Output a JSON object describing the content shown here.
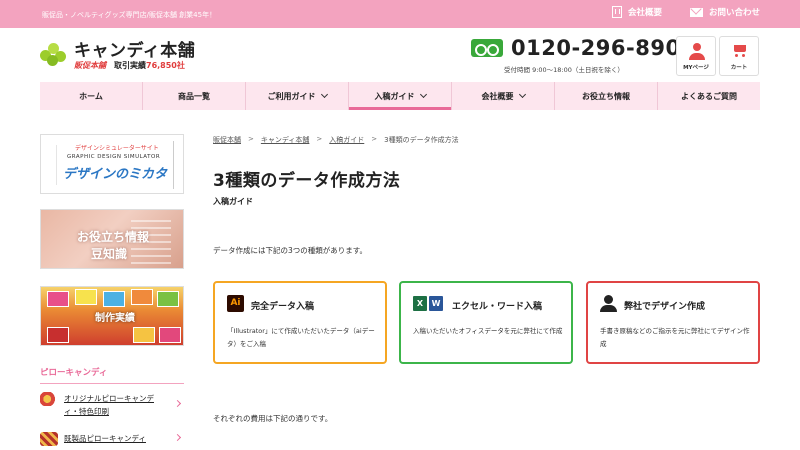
{
  "topbar": {
    "tagline": "販促品・ノベルティグッズ専門店/販促本舗 創業45年！",
    "company_label": "会社概要",
    "contact_label": "お問い合わせ"
  },
  "header": {
    "logo_name": "キャンディ本舗",
    "logo_brand": "販促本舗",
    "logo_trades": "取引実績",
    "logo_count": "76,850社",
    "tel": "0120-296-890",
    "hours": "受付時間 9:00～18:00（土日祝を除く）",
    "mypage_label": "MYページ",
    "cart_label": "カート"
  },
  "nav": {
    "items": [
      {
        "label": "ホーム"
      },
      {
        "label": "商品一覧"
      },
      {
        "label": "ご利用ガイド"
      },
      {
        "label": "入稿ガイド"
      },
      {
        "label": "会社概要"
      },
      {
        "label": "お役立ち情報"
      },
      {
        "label": "よくあるご質問"
      }
    ]
  },
  "sidebar": {
    "banner1": {
      "small": "デザインシミュレーターサイト",
      "sub": "GRAPHIC DESIGN SIMULATOR",
      "title": "デザインのミカタ"
    },
    "banner2": {
      "line1": "お役立ち情報",
      "line2": "豆知識"
    },
    "banner3": {
      "label": "制作実績"
    },
    "heading": "ピローキャンディ",
    "items": [
      {
        "label": "オリジナルピローキャンディ・特色印刷"
      },
      {
        "label": "既製品ピローキャンディ"
      }
    ]
  },
  "breadcrumb": {
    "items": [
      "販促本舗",
      "キャンディ本舗",
      "入稿ガイド",
      "3種類のデータ作成方法"
    ],
    "sep": ">"
  },
  "main": {
    "title": "3種類のデータ作成方法",
    "category": "入稿ガイド",
    "intro": "データ作成には下記の3つの種類があります。",
    "cost_note": "それぞれの費用は下記の通りです。",
    "cards": [
      {
        "title": "完全データ入稿",
        "icon_text": "Ai",
        "desc": "「Illustrator」にて作成いただいたデータ（aiデータ）をご入稿"
      },
      {
        "title": "エクセル・ワード入稿",
        "icon_x": "X",
        "icon_w": "W",
        "desc": "入稿いただいたオフィスデータを元に弊社にて作成"
      },
      {
        "title": "弊社でデザイン作成",
        "desc": "手書き原稿などのご指示を元に弊社にてデザイン作成"
      }
    ]
  },
  "colors": {
    "brand_pink": "#f3a3bf",
    "accent_pink": "#e96a98",
    "card1_border": "#f5a623",
    "card2_border": "#3cb54a",
    "card3_border": "#e04444"
  }
}
